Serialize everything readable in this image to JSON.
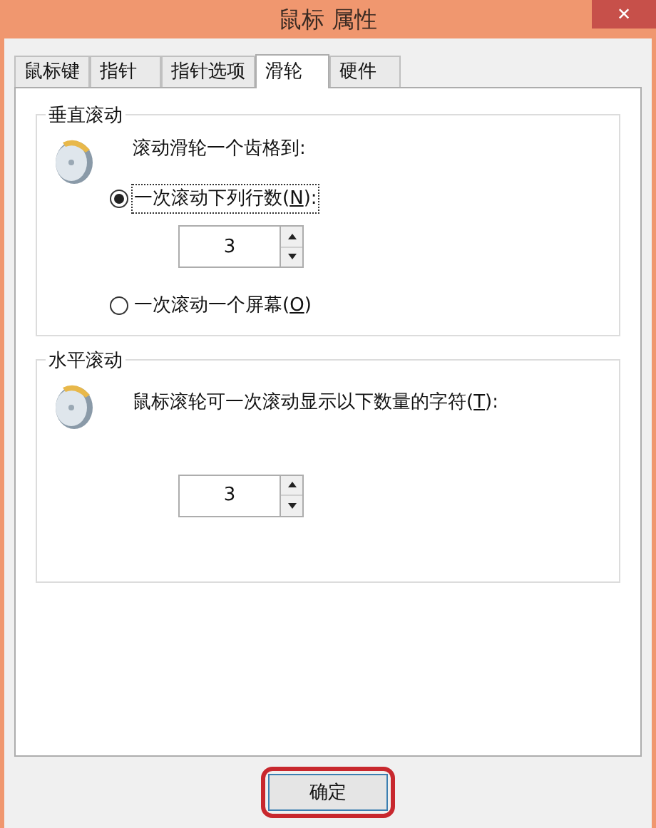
{
  "window": {
    "title": "鼠标 属性",
    "close": "✕"
  },
  "tabs": [
    {
      "label": "鼠标键",
      "selected": false
    },
    {
      "label": "指针",
      "selected": false
    },
    {
      "label": "指针选项",
      "selected": false
    },
    {
      "label": "滑轮",
      "selected": true
    },
    {
      "label": "硬件",
      "selected": false
    }
  ],
  "vertical_scrolling": {
    "title": "垂直滚动",
    "prompt": "滚动滑轮一个齿格到:",
    "options": [
      {
        "label": "一次滚动下列行数(**N**):",
        "selected": true,
        "focused": true
      },
      {
        "label": "一次滚动一个屏幕(**O**)",
        "selected": false,
        "focused": false
      }
    ],
    "lines": "3"
  },
  "horizontal_scrolling": {
    "title": "水平滚动",
    "prompt": "鼠标滚轮可一次滚动显示以下数量的字符(**T**):",
    "chars": "3"
  },
  "buttons": [
    {
      "label": "确定",
      "highlighted": true
    }
  ]
}
